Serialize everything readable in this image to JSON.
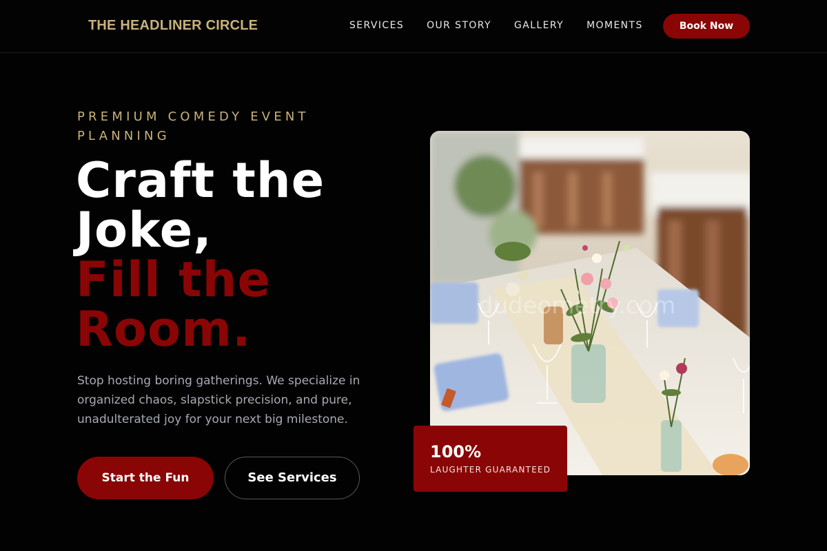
{
  "header": {
    "brand": "THE HEADLINER CIRCLE",
    "nav": [
      "SERVICES",
      "OUR STORY",
      "GALLERY",
      "MOMENTS"
    ],
    "cta": "Book Now"
  },
  "hero": {
    "eyebrow": "PREMIUM COMEDY EVENT PLANNING",
    "headline_line1": "Craft the",
    "headline_line2": "Joke,",
    "headline_line3": "Fill the",
    "headline_line4": "Room.",
    "description": "Stop hosting boring gatherings. We specialize in organized chaos, slapstick precision, and pure, unadulterated joy for your next big milestone.",
    "primary_button": "Start the Fun",
    "secondary_button": "See Services"
  },
  "image": {
    "watermark": "dudeometry.com"
  },
  "stat_badge": {
    "value": "100%",
    "label": "LAUGHTER GUARANTEED"
  },
  "colors": {
    "background": "#020202",
    "accent_red": "#8a0505",
    "gold": "#c9b27a",
    "muted_text": "#a7abb3"
  }
}
